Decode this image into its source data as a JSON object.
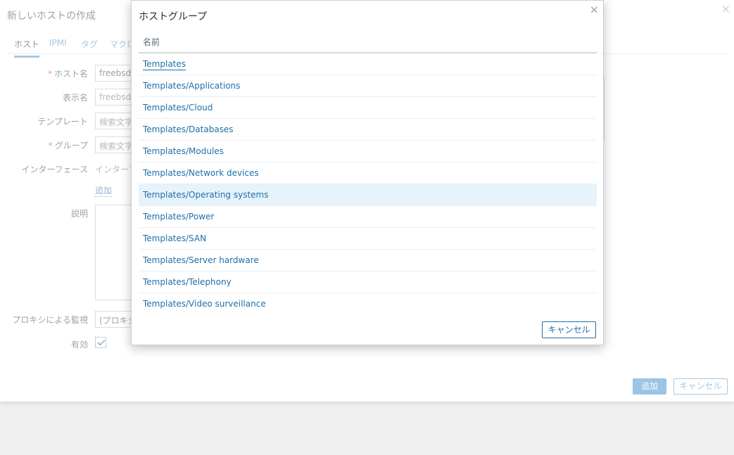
{
  "base_dialog": {
    "title": "新しいホストの作成",
    "close_glyph": "×",
    "tabs": [
      {
        "label": "ホスト",
        "active": true
      },
      {
        "label": "IPMI",
        "active": false
      },
      {
        "label": "タグ",
        "active": false
      },
      {
        "label": "マクロ",
        "active": false
      }
    ],
    "fields": {
      "host_name": {
        "label": "ホスト名",
        "required": "*",
        "value": "freebsd-"
      },
      "display_name": {
        "label": "表示名",
        "placeholder": "freebsd-"
      },
      "templates": {
        "label": "テンプレート",
        "placeholder": "検索文字"
      },
      "groups": {
        "label": "グループ",
        "required": "*",
        "placeholder": "検索文字"
      },
      "interfaces": {
        "label": "インターフェース",
        "text": "インターフ",
        "add_link": "追加"
      },
      "description": {
        "label": "説明"
      },
      "proxy": {
        "label": "プロキシによる監視",
        "value": "(プロキシ"
      },
      "enabled": {
        "label": "有効",
        "checked": true
      }
    },
    "buttons": {
      "add": "追加",
      "cancel": "キャンセル"
    }
  },
  "popup": {
    "title": "ホストグループ",
    "close_glyph": "×",
    "column_header": "名前",
    "rows": [
      {
        "label": "Templates",
        "highlight": false
      },
      {
        "label": "Templates/Applications",
        "highlight": false
      },
      {
        "label": "Templates/Cloud",
        "highlight": false
      },
      {
        "label": "Templates/Databases",
        "highlight": false
      },
      {
        "label": "Templates/Modules",
        "highlight": false
      },
      {
        "label": "Templates/Network devices",
        "highlight": false
      },
      {
        "label": "Templates/Operating systems",
        "highlight": true
      },
      {
        "label": "Templates/Power",
        "highlight": false
      },
      {
        "label": "Templates/SAN",
        "highlight": false
      },
      {
        "label": "Templates/Server hardware",
        "highlight": false
      },
      {
        "label": "Templates/Telephony",
        "highlight": false
      },
      {
        "label": "Templates/Video surveillance",
        "highlight": false
      }
    ],
    "cancel_label": "キャンセル"
  },
  "colors": {
    "link": "#1f6fa8",
    "highlight_row": "#e7f3fb",
    "primary_button": "#9cc4e4"
  },
  "icons": {
    "close": "close-icon",
    "check": "check-icon"
  }
}
